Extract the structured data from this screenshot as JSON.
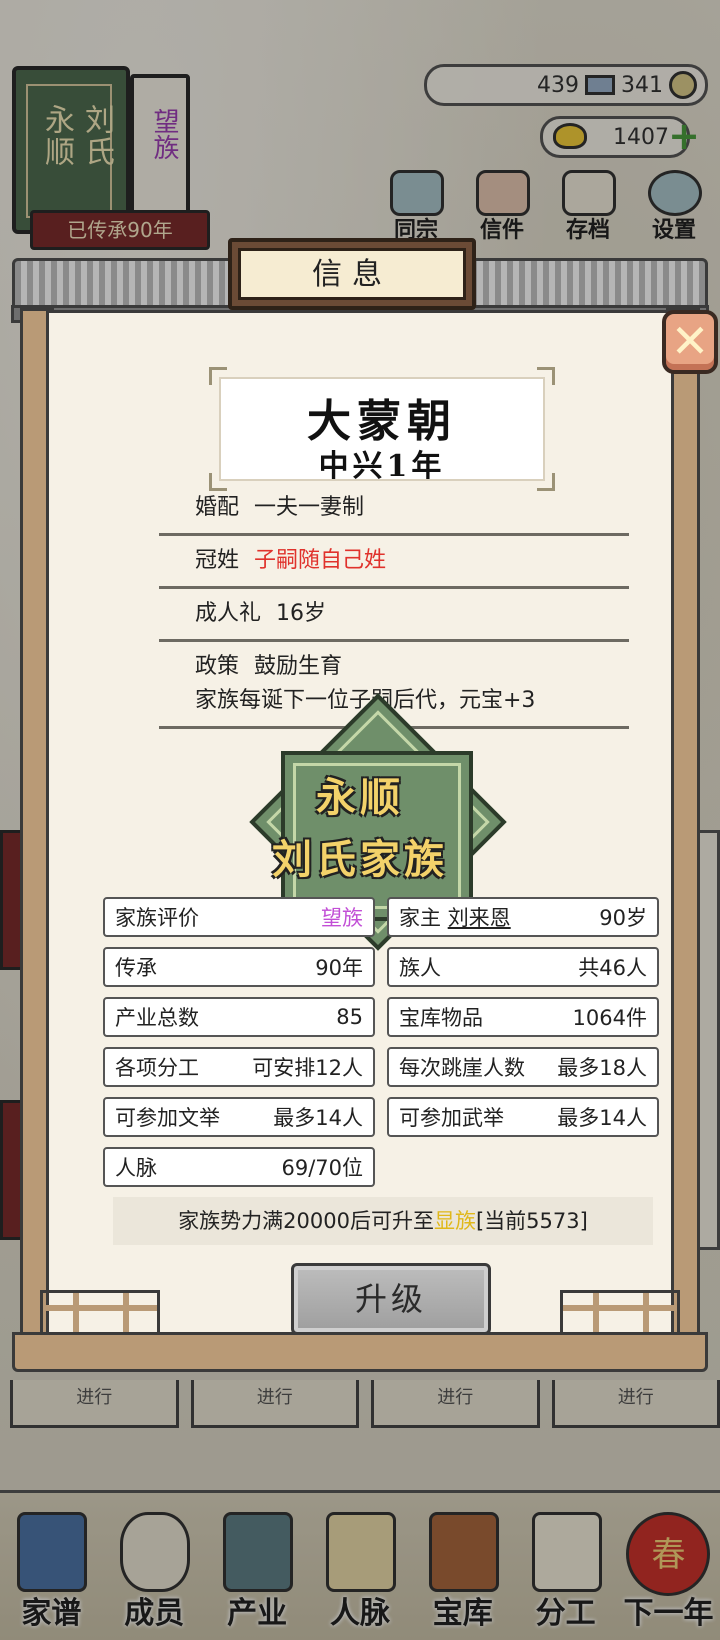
{
  "family_book": {
    "title_right": "刘氏",
    "title_left": "永顺",
    "rank": "望族",
    "ribbon": "已传承90年"
  },
  "resources": {
    "silver": "439",
    "coins": "341",
    "gold": "1407"
  },
  "top_menu": {
    "items": [
      "同宗",
      "信件",
      "存档",
      "设置"
    ]
  },
  "background_cards": [
    "进行",
    "进行",
    "进行",
    "进行"
  ],
  "bottom_nav": {
    "items": [
      "家谱",
      "成员",
      "产业",
      "人脉",
      "宝库",
      "分工",
      "下一年"
    ],
    "next_badge": "春"
  },
  "modal": {
    "title": "信息",
    "close_icon": "close-icon",
    "dynasty": {
      "name": "大蒙朝",
      "year": "中兴1年"
    },
    "rules": {
      "marriage_label": "婚配",
      "marriage_value": "一夫一妻制",
      "surname_label": "冠姓",
      "surname_value": "子嗣随自己姓",
      "coming_of_age_label": "成人礼",
      "coming_of_age_value": "16岁",
      "policy_label": "政策",
      "policy_value": "鼓励生育",
      "policy_desc": "家族每诞下一位子嗣后代，元宝+3"
    },
    "emblem": {
      "line1": "永顺",
      "line2": "刘氏家族"
    },
    "stats": {
      "rating_label": "家族评价",
      "rating_value": "望族",
      "head_label": "家主",
      "head_name": "刘来恩",
      "head_age": "90岁",
      "heritage_label": "传承",
      "heritage_value": "90年",
      "members_label": "族人",
      "members_value": "共46人",
      "industry_label": "产业总数",
      "industry_value": "85",
      "treasury_label": "宝库物品",
      "treasury_value": "1064件",
      "labor_label": "各项分工",
      "labor_value": "可安排12人",
      "cliff_label": "每次跳崖人数",
      "cliff_value": "最多18人",
      "civil_exam_label": "可参加文举",
      "civil_exam_value": "最多14人",
      "military_exam_label": "可参加武举",
      "military_exam_value": "最多14人",
      "network_label": "人脉",
      "network_value": "69/70位"
    },
    "notice": {
      "prefix": "家族势力满20000后可升至",
      "rank": "显族",
      "suffix": "[当前5573]"
    },
    "upgrade_label": "升级"
  },
  "colors": {
    "rank_purple": "#c24fd6",
    "red_text": "#e0322c",
    "next_rank_yellow": "#e0b81a",
    "emblem_green": "#6f8f6a"
  }
}
